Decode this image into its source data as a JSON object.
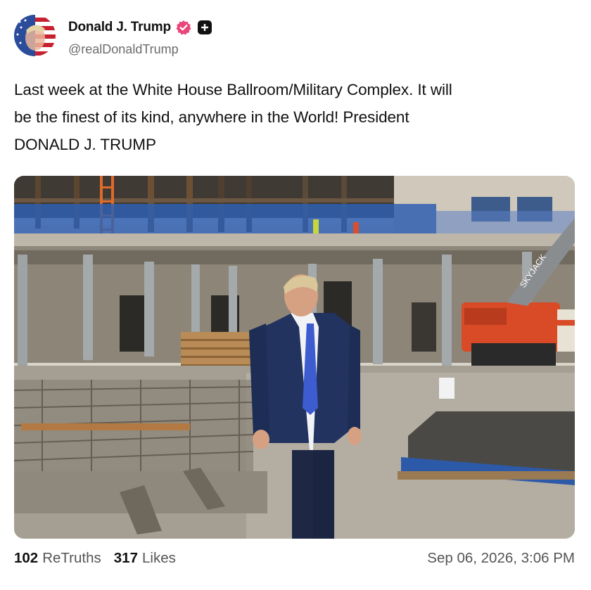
{
  "author": {
    "display_name": "Donald J. Trump",
    "handle": "@realDonaldTrump",
    "verified_icon": "verified-badge-icon",
    "plus_icon": "plus-badge-icon"
  },
  "post": {
    "text_line_1": "Last week at the White House Ballroom/Military Complex. It will",
    "text_line_2": "be the finest of its kind, anywhere in the World! President",
    "text_line_3": "DONALD J. TRUMP"
  },
  "media": {
    "lift_brand": "SKYJACK"
  },
  "footer": {
    "retruths_count": "102",
    "retruths_label": "ReTruths",
    "likes_count": "317",
    "likes_label": "Likes",
    "timestamp": "Sep 06, 2026, 3:06 PM"
  },
  "colors": {
    "verified_pink": "#e8457a",
    "text": "#111111",
    "muted": "#6b6b6b"
  }
}
